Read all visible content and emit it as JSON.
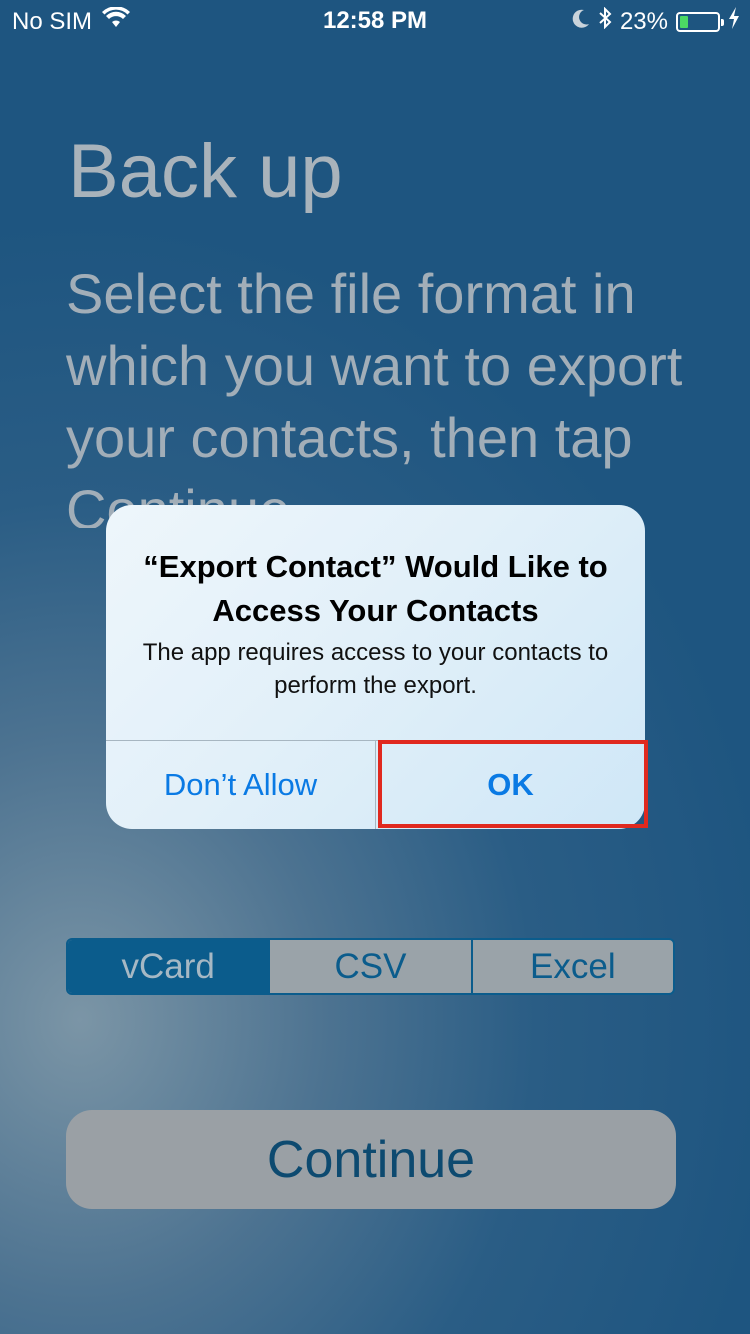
{
  "status_bar": {
    "carrier": "No SIM",
    "time": "12:58 PM",
    "battery_percent": "23%",
    "battery_level": 0.23,
    "icons": [
      "wifi-icon",
      "moon-icon",
      "bluetooth-icon",
      "battery-icon",
      "charging-icon"
    ]
  },
  "page": {
    "title": "Back up",
    "instructions": "Select the file format in which you want to export your contacts, then tap Continue."
  },
  "dialog": {
    "title": "“Export Contact” Would Like to Access Your Contacts",
    "message": "The app requires access to your contacts to perform the export.",
    "dont_allow_label": "Don’t Allow",
    "ok_label": "OK"
  },
  "format_selector": {
    "options": [
      "vCard",
      "CSV",
      "Excel"
    ],
    "selected": "vCard"
  },
  "continue_label": "Continue",
  "colors": {
    "accent": "#0a7ae4",
    "highlight": "#e0291f",
    "segment": "#0b5c8c"
  }
}
